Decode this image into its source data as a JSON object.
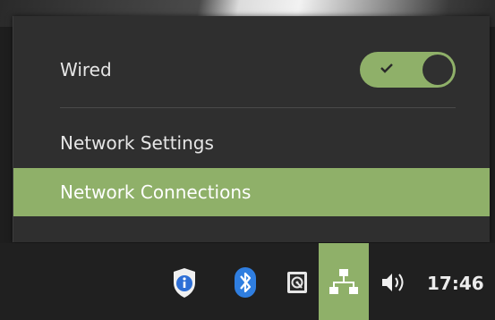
{
  "network_menu": {
    "wired": {
      "label": "Wired",
      "enabled": true
    },
    "items": [
      {
        "label": "Network Settings",
        "highlighted": false
      },
      {
        "label": "Network Connections",
        "highlighted": true
      }
    ]
  },
  "panel": {
    "tray_icons": [
      "shield-info-icon",
      "bluetooth-icon",
      "disk-icon",
      "network-wired-icon",
      "volume-icon"
    ],
    "clock": "17:46"
  },
  "colors": {
    "accent": "#8fb069",
    "menu_background": "#2f2f2f",
    "panel_background": "#202020"
  }
}
